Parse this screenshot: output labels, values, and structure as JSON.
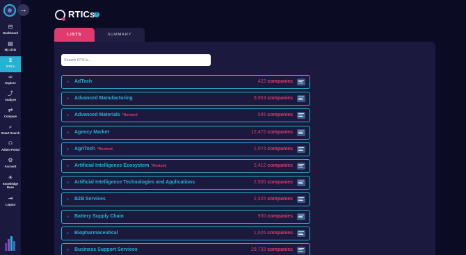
{
  "sidebar": {
    "items": [
      {
        "label": "Dashboard",
        "icon": "dashboard-icon",
        "glyph": "⊟"
      },
      {
        "label": "My Lists",
        "icon": "my-lists-icon",
        "glyph": "▤"
      },
      {
        "label": "RTICs",
        "icon": "rtics-icon",
        "glyph": "⧗",
        "active": true
      },
      {
        "label": "Explore",
        "icon": "explore-icon",
        "glyph": "∞"
      },
      {
        "label": "Analyse",
        "icon": "analyse-icon",
        "glyph": "⤴"
      },
      {
        "label": "Compare",
        "icon": "compare-icon",
        "glyph": "⇄"
      },
      {
        "label": "Smart Search",
        "icon": "search-icon",
        "glyph": "⌕"
      },
      {
        "label": "Admin Portal",
        "icon": "admin-icon",
        "glyph": "⚇"
      },
      {
        "label": "Account",
        "icon": "gear-icon",
        "glyph": "⚙"
      },
      {
        "label": "Knowledge Base",
        "icon": "knowledge-icon",
        "glyph": "☀"
      },
      {
        "label": "Logout",
        "icon": "logout-icon",
        "glyph": "⇥"
      }
    ],
    "toggle_glyph": "→"
  },
  "header": {
    "title": "RTICs",
    "help": "?"
  },
  "tabs": [
    {
      "label": "LISTS",
      "active": true
    },
    {
      "label": "SUMMARY",
      "active": false
    }
  ],
  "search": {
    "placeholder": "Search RTICs..."
  },
  "unit_label": "companies",
  "revised_label": "*Revised",
  "rows": [
    {
      "name": "AdTech",
      "count": "422",
      "revised": false
    },
    {
      "name": "Advanced Manufacturing",
      "count": "9,963",
      "revised": false
    },
    {
      "name": "Advanced Materials",
      "count": "585",
      "revised": true
    },
    {
      "name": "Agency Market",
      "count": "12,472",
      "revised": false
    },
    {
      "name": "AgriTech",
      "count": "1,074",
      "revised": true
    },
    {
      "name": "Artificial Intelligence Ecosystem",
      "count": "2,412",
      "revised": true
    },
    {
      "name": "Artificial Intelligence Technologies and Applications",
      "count": "2,900",
      "revised": false
    },
    {
      "name": "B2B Services",
      "count": "2,425",
      "revised": false
    },
    {
      "name": "Battery Supply Chain",
      "count": "930",
      "revised": false
    },
    {
      "name": "Biopharmaceutical",
      "count": "1,026",
      "revised": false
    },
    {
      "name": "Business Support Services",
      "count": "29,733",
      "revised": false
    }
  ],
  "colors": {
    "accent_cyan": "#25b3d2",
    "accent_pink": "#e13a6e",
    "panel": "#1b1a3e",
    "background": "#0c0b24"
  }
}
